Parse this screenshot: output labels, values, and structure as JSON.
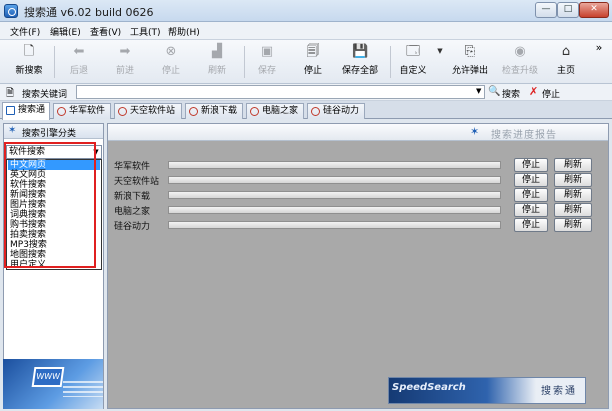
{
  "window": {
    "title": "搜索通 v6.02 build 0626"
  },
  "menu": [
    {
      "label": "文件(F)"
    },
    {
      "label": "编辑(E)"
    },
    {
      "label": "查看(V)"
    },
    {
      "label": "工具(T)"
    },
    {
      "label": "帮助(H)"
    }
  ],
  "toolbar": {
    "new_search": "新搜索",
    "back": "后退",
    "forward": "前进",
    "stop": "停止",
    "refresh": "刷新",
    "save": "保存",
    "stop2": "停止",
    "save_all": "保存全部",
    "customize": "自定义",
    "allow_popup": "允许弹出",
    "check_update": "检查升级",
    "home": "主页",
    "more": "»"
  },
  "search": {
    "label": "搜索关键词",
    "keyword": "",
    "search_button": "搜索",
    "stop_button": "停止"
  },
  "tabs": [
    {
      "label": "搜索通",
      "active": true
    },
    {
      "label": "华军软件"
    },
    {
      "label": "天空软件站"
    },
    {
      "label": "新浪下载"
    },
    {
      "label": "电脑之家"
    },
    {
      "label": "硅谷动力"
    }
  ],
  "left_panel": {
    "header": "搜索引擎分类",
    "selected": "软件搜索",
    "options": [
      {
        "label": "中文网页",
        "selected": true
      },
      {
        "label": "英文网页"
      },
      {
        "label": "软件搜索"
      },
      {
        "label": "新闻搜索"
      },
      {
        "label": "图片搜索"
      },
      {
        "label": "词典搜索"
      },
      {
        "label": "购书搜索"
      },
      {
        "label": "拍卖搜索"
      },
      {
        "label": "MP3搜索"
      },
      {
        "label": "地图搜索"
      },
      {
        "label": "用户定义"
      }
    ],
    "image_text": "WWW"
  },
  "right_panel": {
    "header": "搜索进度报告",
    "rows": [
      {
        "name": "华军软件",
        "progress": 0,
        "stop": "停止",
        "refresh": "刷新"
      },
      {
        "name": "天空软件站",
        "progress": 0,
        "stop": "停止",
        "refresh": "刷新"
      },
      {
        "name": "新浪下载",
        "progress": 0,
        "stop": "停止",
        "refresh": "刷新"
      },
      {
        "name": "电脑之家",
        "progress": 0,
        "stop": "停止",
        "refresh": "刷新"
      },
      {
        "name": "硅谷动力",
        "progress": 0,
        "stop": "停止",
        "refresh": "刷新"
      }
    ],
    "brand_left": "SpeedSearch",
    "brand_right": "搜索通"
  },
  "colors": {
    "selection": "#3399ff",
    "highlight_box": "#e02020",
    "panel_bg": "#a9a9a9"
  }
}
